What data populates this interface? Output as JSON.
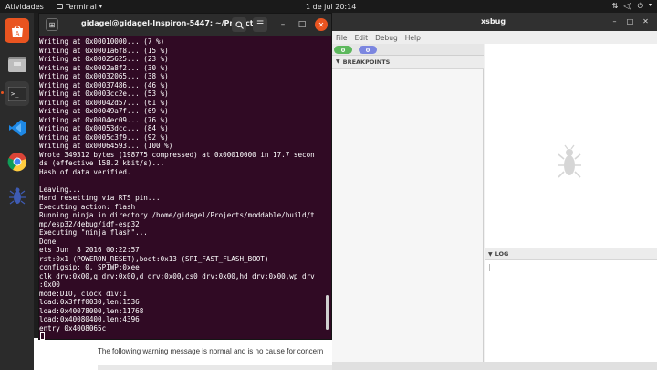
{
  "topbar": {
    "activities": "Atividades",
    "app_name": "Terminal",
    "clock": "1 de jul  20:14"
  },
  "dock": {
    "items": [
      {
        "name": "software-store"
      },
      {
        "name": "files"
      },
      {
        "name": "terminal"
      },
      {
        "name": "vscode"
      },
      {
        "name": "chrome"
      },
      {
        "name": "xsbug"
      }
    ]
  },
  "terminal": {
    "title": "gidagel@gidagel-Inspiron-5447: ~/Projects...",
    "lines": [
      "Writing at 0x00010000... (7 %)",
      "Writing at 0x0001a6f8... (15 %)",
      "Writing at 0x00025625... (23 %)",
      "Writing at 0x0002a8f2... (30 %)",
      "Writing at 0x00032065... (38 %)",
      "Writing at 0x00037486... (46 %)",
      "Writing at 0x0003cc2e... (53 %)",
      "Writing at 0x00042d57... (61 %)",
      "Writing at 0x00049a7f... (69 %)",
      "Writing at 0x0004ec09... (76 %)",
      "Writing at 0x00053dcc... (84 %)",
      "Writing at 0x0005c3f9... (92 %)",
      "Writing at 0x00064593... (100 %)",
      "Wrote 349312 bytes (198775 compressed) at 0x00010000 in 17.7 secon",
      "ds (effective 158.2 kbit/s)...",
      "Hash of data verified.",
      "",
      "Leaving...",
      "Hard resetting via RTS pin...",
      "Executing action: flash",
      "Running ninja in directory /home/gidagel/Projects/moddable/build/t",
      "mp/esp32/debug/idf-esp32",
      "Executing \"ninja flash\"...",
      "Done",
      "ets Jun  8 2016 00:22:57",
      "rst:0x1 (POWERON_RESET),boot:0x13 (SPI_FAST_FLASH_BOOT)",
      "configsip: 0, SPIWP:0xee",
      "clk_drv:0x00,q_drv:0x00,d_drv:0x00,cs0_drv:0x00,hd_drv:0x00,wp_drv",
      ":0x00",
      "mode:DIO, clock div:1",
      "load:0x3fff0030,len:1536",
      "load:0x40078000,len:11768",
      "load:0x40080400,len:4396",
      "entry 0x4008065c"
    ]
  },
  "xsbug": {
    "title": "xsbug",
    "menu": [
      "File",
      "Edit",
      "Debug",
      "Help"
    ],
    "counter_left": "0",
    "counter_right": "0",
    "breakpoints_header": "BREAKPOINTS",
    "log_header": "LOG"
  },
  "background_page": {
    "message": "The following warning message is normal and is no cause for concern"
  }
}
